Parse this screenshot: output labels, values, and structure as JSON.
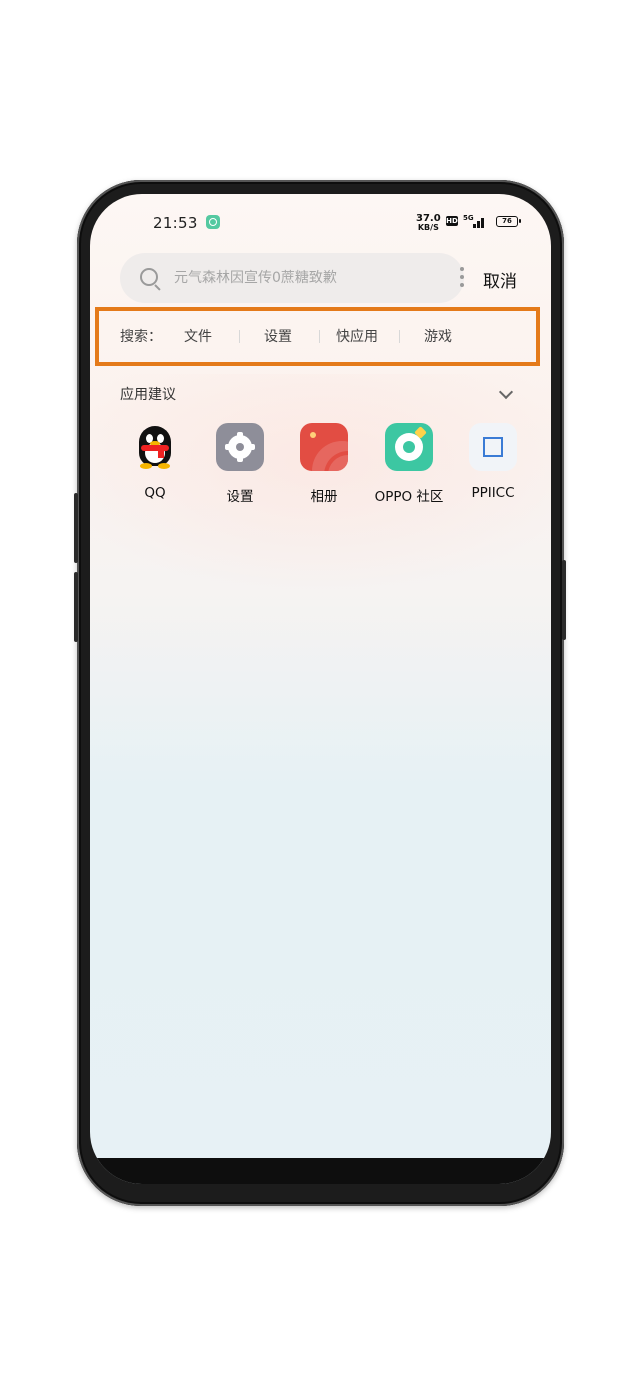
{
  "status_bar": {
    "time": "21:53",
    "net_speed_value": "37.0",
    "net_speed_unit": "KB/S",
    "hd_label": "HD",
    "network_type": "5G",
    "battery": "76"
  },
  "search": {
    "placeholder": "元气森林因宣传0蔗糖致歉",
    "value": "",
    "cancel_label": "取消"
  },
  "search_categories": {
    "label": "搜索：",
    "items": [
      "文件",
      "设置",
      "快应用",
      "游戏"
    ]
  },
  "suggestions": {
    "title": "应用建议",
    "apps": [
      {
        "label": "QQ",
        "icon": "qq-icon"
      },
      {
        "label": "设置",
        "icon": "settings-gear-icon"
      },
      {
        "label": "相册",
        "icon": "album-icon"
      },
      {
        "label": "OPPO 社区",
        "icon": "oppo-community-icon"
      },
      {
        "label": "PPIICC",
        "icon": "ppiicc-icon"
      }
    ]
  },
  "colors": {
    "highlight_border": "#e47a1a",
    "settings_icon": "#8e8e99",
    "album_icon": "#e24d43",
    "oppo_icon": "#3cc7a2"
  }
}
